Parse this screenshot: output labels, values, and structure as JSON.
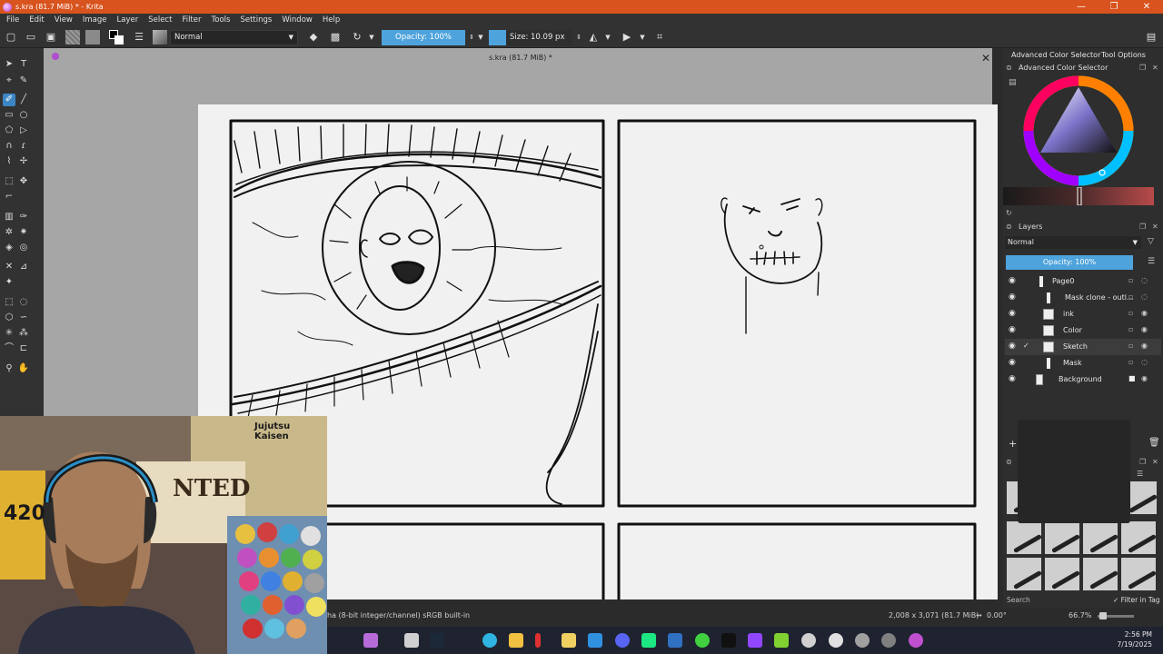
{
  "window": {
    "title": "s.kra (81.7 MiB) * - Krita",
    "min_glyph": "—",
    "max_glyph": "❐",
    "close_glyph": "✕"
  },
  "menu": [
    "File",
    "Edit",
    "View",
    "Image",
    "Layer",
    "Select",
    "Filter",
    "Tools",
    "Settings",
    "Window",
    "Help"
  ],
  "toolbar": {
    "blend_mode": "Normal",
    "opacity": "Opacity: 100%",
    "size": "Size: 10.09 px"
  },
  "document": {
    "tab_title": "s.kra (81.7 MiB) *",
    "close_glyph": "✕"
  },
  "docker": {
    "tabs": [
      "Advanced Color Selector",
      "Tool Options"
    ],
    "color_selector_title": "Advanced Color Selector",
    "layers_title": "Layers",
    "layers_blend": "Normal",
    "layers_opacity": "Opacity:  100%",
    "layers": [
      {
        "name": "Page0",
        "kind": "group",
        "indent": 0
      },
      {
        "name": "Mask clone - outl...",
        "kind": "clone",
        "indent": 1
      },
      {
        "name": "ink",
        "kind": "paint",
        "indent": 1
      },
      {
        "name": "Color",
        "kind": "paint",
        "indent": 1
      },
      {
        "name": "Sketch",
        "kind": "paint",
        "indent": 1,
        "selected": true
      },
      {
        "name": "Mask",
        "kind": "clone",
        "indent": 1
      },
      {
        "name": "Background",
        "kind": "paint",
        "indent": 0,
        "locked": true
      }
    ],
    "search_label": "Search",
    "filter_in_tag": "Filter in Tag"
  },
  "status": {
    "color_space": "ha (8-bit integer/channel)  sRGB built-in",
    "dimensions": "2,008 x 3,071 (81.7 MiB)",
    "rotation": "0.00°",
    "zoom": "66.7%"
  },
  "clock": {
    "time": "2:56 PM",
    "date": "7/19/2025"
  },
  "webcam": {
    "poster_text": "Jujutsu Kaisen",
    "wanted_text": "NTED",
    "sticker_number": "420"
  },
  "colors": {
    "accent": "#4ea3dc",
    "titlebar": "#d8531e",
    "panel": "#323232",
    "canvas_bg": "#a6a6a6",
    "page": "#f1f1f1"
  }
}
